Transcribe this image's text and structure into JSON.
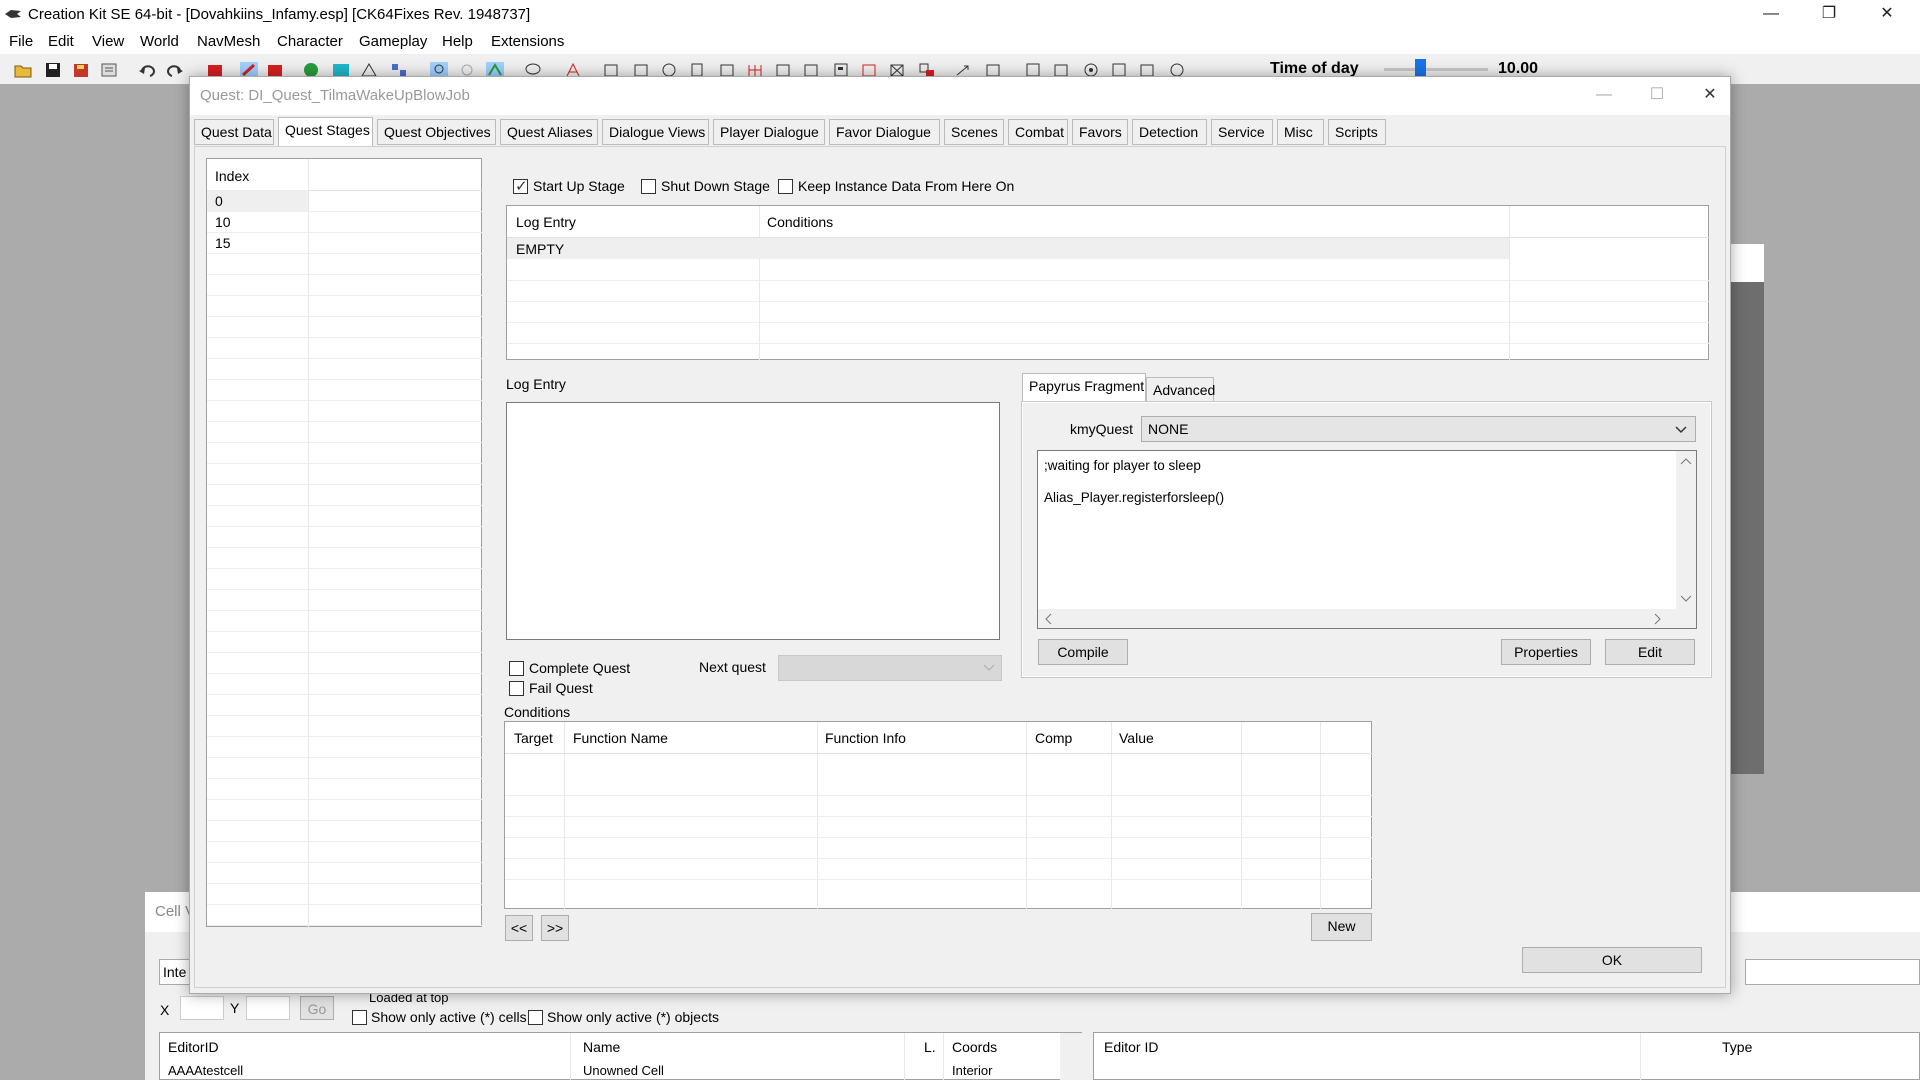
{
  "app": {
    "title": "Creation Kit SE 64-bit - [Dovahkiins_Infamy.esp] [CK64Fixes Rev. 1948737]",
    "win_controls": [
      "—",
      "❐",
      "✕"
    ]
  },
  "menu": [
    "File",
    "Edit",
    "View",
    "World",
    "NavMesh",
    "Character",
    "Gameplay",
    "Help",
    "Extensions"
  ],
  "toolbar": {
    "time_of_day_label": "Time of day",
    "time_of_day_value": "10.00",
    "time_of_day_fraction": 0.35
  },
  "cell_view": {
    "title": "Cell V",
    "interior_label": "Inte",
    "x_label": "X",
    "y_label": "Y",
    "go": "Go",
    "loaded_at_top": "Loaded at top",
    "only_active_cells": "Show only active (*) cells",
    "only_active_objects": "Show only active (*) objects",
    "cols": [
      "EditorID",
      "Name",
      "L.",
      "Coords"
    ],
    "row": [
      "AAAAtestcell",
      "Unowned Cell",
      "",
      "Interior"
    ],
    "right_cols": [
      "Editor ID",
      "Type"
    ]
  },
  "dialog": {
    "title": "Quest: DI_Quest_TilmaWakeUpBlowJob",
    "controls": [
      "—",
      "☐",
      "✕"
    ],
    "tabs": [
      "Quest Data",
      "Quest Stages",
      "Quest Objectives",
      "Quest Aliases",
      "Dialogue Views",
      "Player Dialogue",
      "Favor Dialogue",
      "Scenes",
      "Combat",
      "Favors",
      "Detection",
      "Service",
      "Misc",
      "Scripts"
    ],
    "active_tab": "Quest Stages",
    "index_header": "Index",
    "indices": [
      "0",
      "10",
      "15"
    ],
    "start_up_stage": "Start Up Stage",
    "start_up_checked": true,
    "shut_down_stage": "Shut Down Stage",
    "keep_instance": "Keep Instance Data From Here On",
    "log_cols": [
      "Log Entry",
      "Conditions"
    ],
    "log_rows": [
      "EMPTY"
    ],
    "log_entry_label": "Log Entry",
    "complete_quest": "Complete Quest",
    "fail_quest": "Fail Quest",
    "next_quest": "Next quest",
    "conditions_label": "Conditions",
    "cond_cols": [
      "Target",
      "Function Name",
      "Function Info",
      "Comp",
      "Value"
    ],
    "prev_btn": "<<",
    "next_btn": ">>",
    "new_btn": "New",
    "ok_btn": "OK",
    "papyrus_tab": "Papyrus Fragment",
    "advanced_tab": "Advanced",
    "kmyquest_label": "kmyQuest",
    "kmyquest_value": "NONE",
    "script_line1": ";waiting for player to sleep",
    "script_line2": "Alias_Player.registerforsleep()",
    "compile_btn": "Compile",
    "properties_btn": "Properties",
    "edit_btn": "Edit"
  }
}
